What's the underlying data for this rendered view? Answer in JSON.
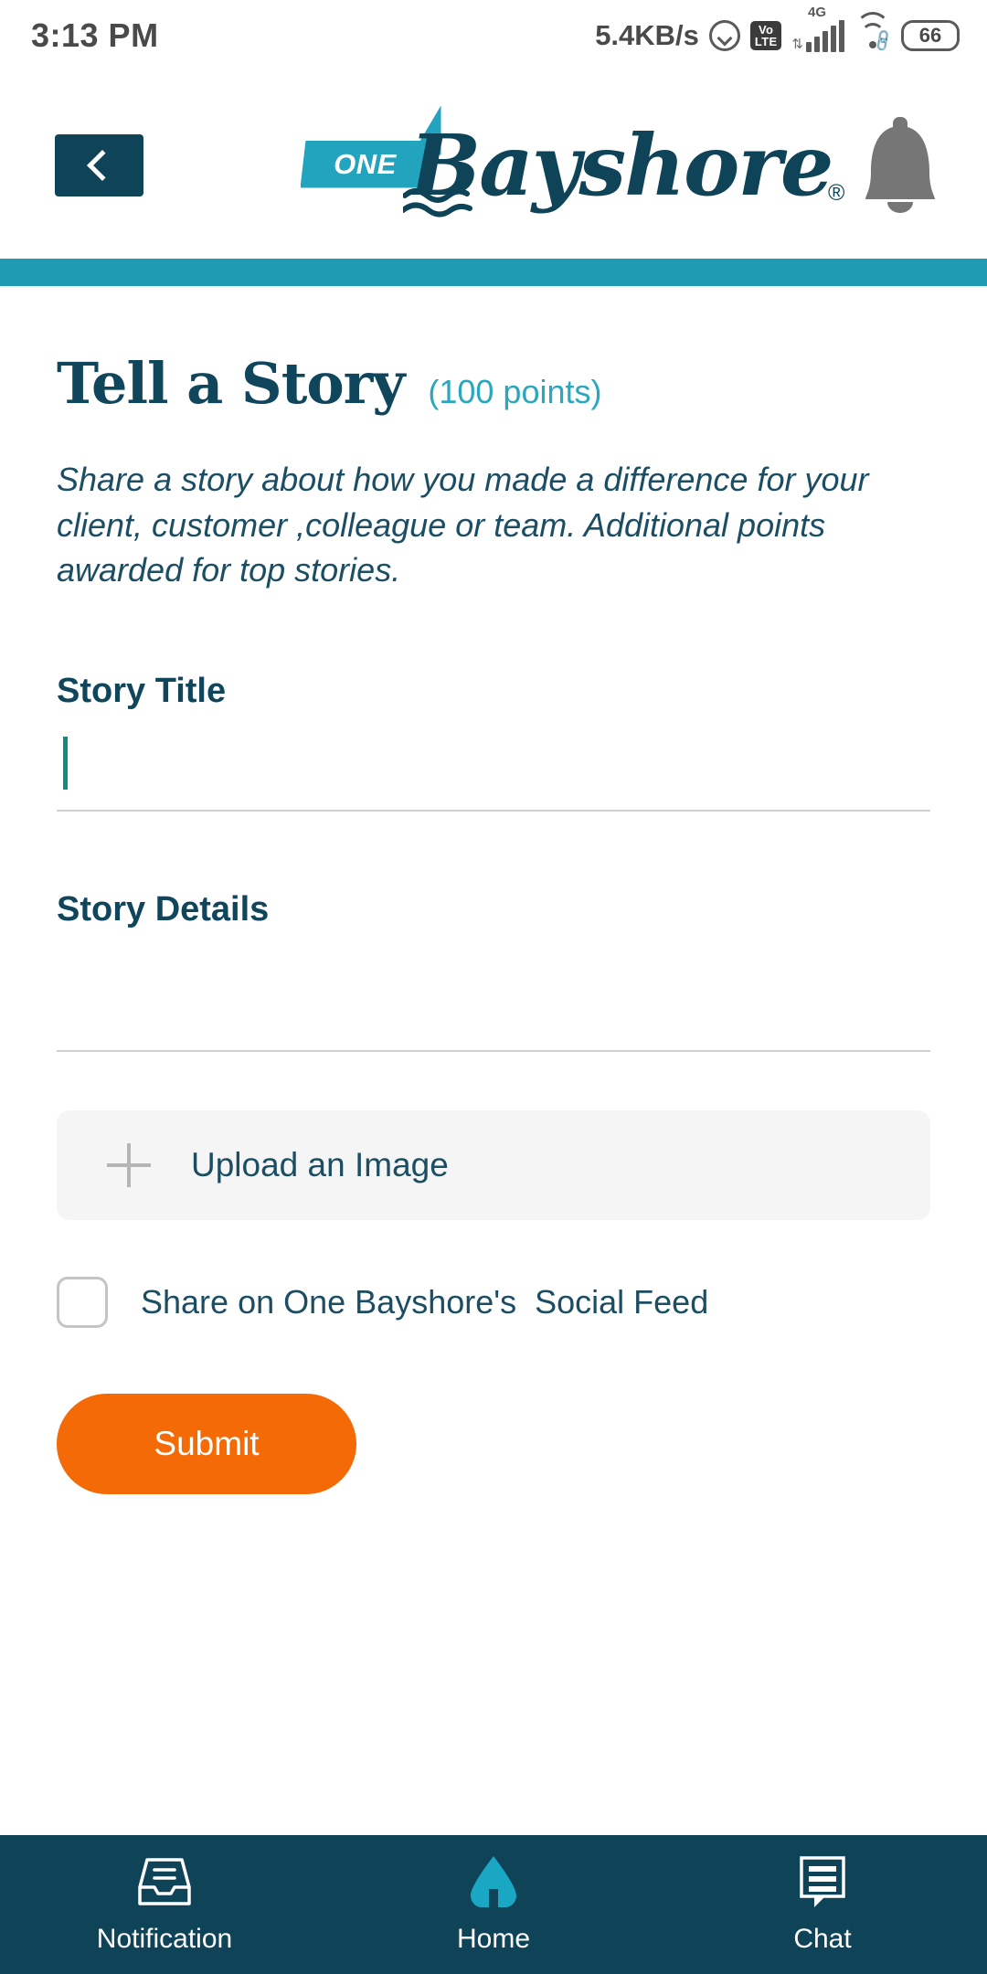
{
  "status_bar": {
    "time": "3:13 PM",
    "network_speed": "5.4KB/s",
    "volte_top": "Vo",
    "volte_bottom": "LTE",
    "network_type": "4G",
    "battery": "66"
  },
  "header": {
    "back_icon": "chevron-left-icon",
    "logo_badge": "ONE",
    "logo_name": "Bayshore",
    "logo_trademark": "®",
    "bell_icon": "bell-icon"
  },
  "page": {
    "title": "Tell a Story",
    "points": "(100 points)",
    "description": "Share a story about how you made a difference for your client, customer ,colleague or team. Additional points awarded for top stories."
  },
  "form": {
    "story_title_label": "Story Title",
    "story_title_value": "",
    "story_title_placeholder": "",
    "story_details_label": "Story Details",
    "story_details_value": "",
    "story_details_placeholder": "",
    "upload_label": "Upload an Image",
    "upload_icon": "plus-icon",
    "share_checkbox_label": "Share on One Bayshore's  Social Feed",
    "share_checkbox_checked": false,
    "submit_label": "Submit"
  },
  "bottom_nav": {
    "items": [
      {
        "label": "Notification",
        "icon": "inbox-tray-icon",
        "active": false
      },
      {
        "label": "Home",
        "icon": "home-icon",
        "active": true
      },
      {
        "label": "Chat",
        "icon": "chat-bubble-icon",
        "active": false
      }
    ]
  },
  "colors": {
    "navy": "#0e4358",
    "teal": "#1f9cb4",
    "teal_light": "#2aa7bd",
    "orange": "#f46a06",
    "caret_green": "#108c7e"
  }
}
